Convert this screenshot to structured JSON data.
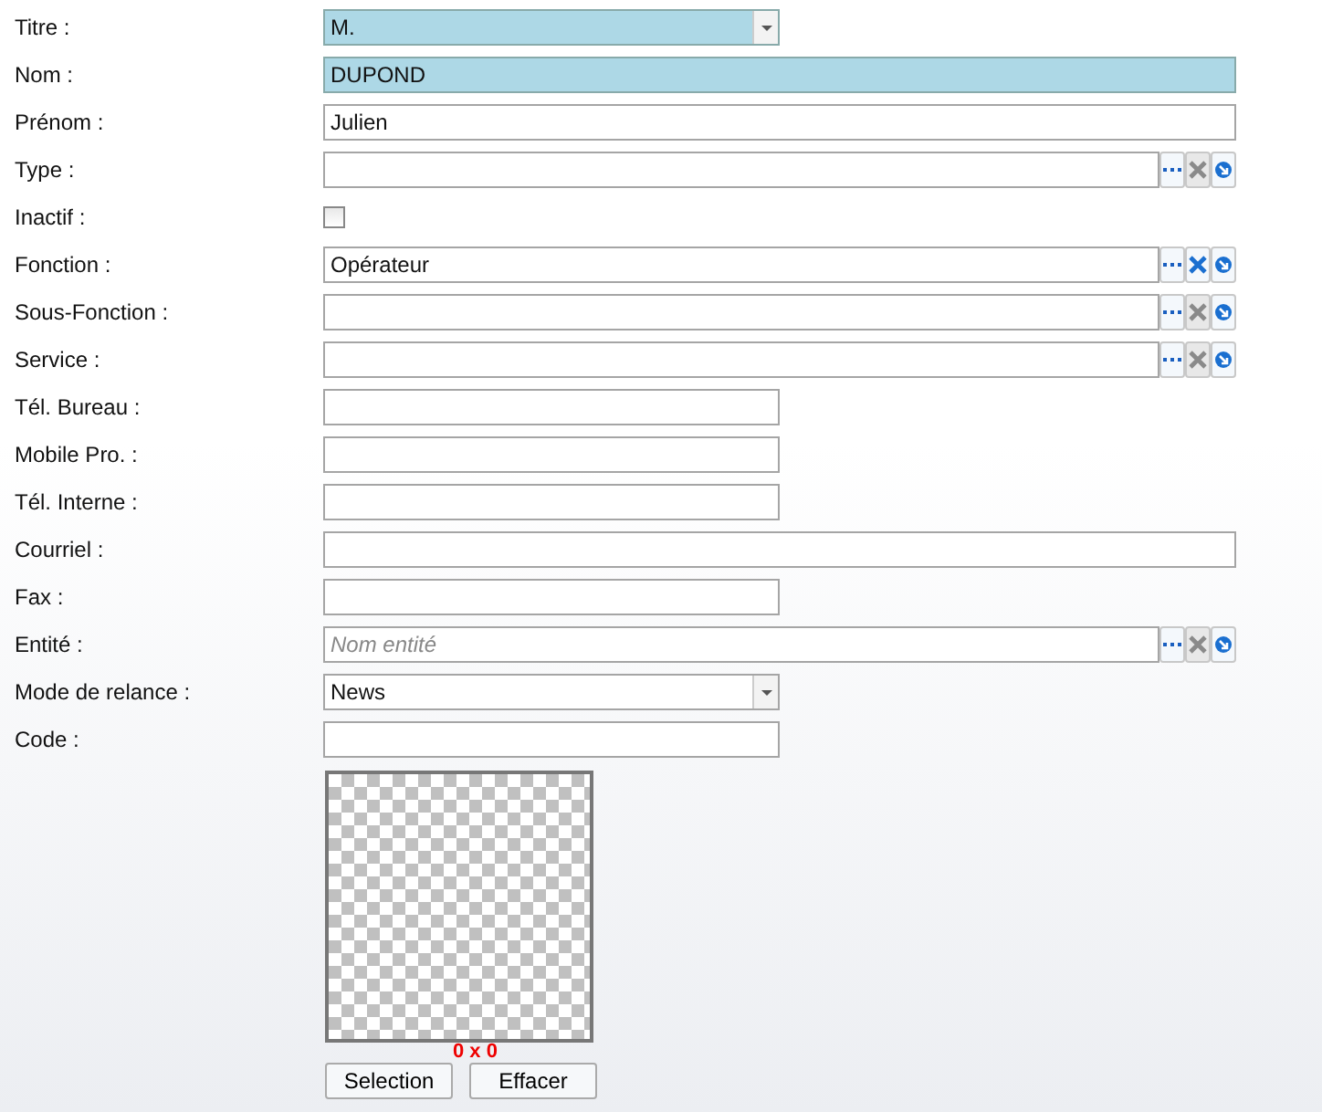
{
  "fields": [
    {
      "label": "Titre :",
      "kind": "select",
      "value": "M.",
      "required": true
    },
    {
      "label": "Nom :",
      "kind": "longtext",
      "value": "DUPOND",
      "required": true
    },
    {
      "label": "Prénom :",
      "kind": "longtext",
      "value": "Julien",
      "required": false
    },
    {
      "label": "Type :",
      "kind": "lookup",
      "clear_enabled": false
    },
    {
      "label": "Inactif :",
      "kind": "checkbox",
      "checked": false
    },
    {
      "label": "Fonction :",
      "kind": "lookup",
      "value": "Opérateur",
      "clear_enabled": true
    },
    {
      "label": "Sous-Fonction :",
      "kind": "lookup",
      "clear_enabled": false
    },
    {
      "label": "Service :",
      "kind": "lookup",
      "clear_enabled": false
    },
    {
      "label": "Tél. Bureau :",
      "kind": "shorttext",
      "required": false
    },
    {
      "label": "Mobile Pro. :",
      "kind": "shorttext",
      "required": false
    },
    {
      "label": "Tél. Interne :",
      "kind": "shorttext",
      "required": false
    },
    {
      "label": "Courriel :",
      "kind": "longtext",
      "required": false
    },
    {
      "label": "Fax :",
      "kind": "shorttext",
      "required": false
    },
    {
      "label": "Entité :",
      "kind": "lookup",
      "placeholder": "Nom entité",
      "clear_enabled": false
    },
    {
      "label": "Mode de relance :",
      "kind": "select",
      "value": "News",
      "required": false
    },
    {
      "label": "Code :",
      "kind": "shorttext",
      "required": false
    }
  ],
  "image": {
    "size_caption": "0 x 0",
    "buttons": [
      "Selection",
      "Effacer"
    ]
  }
}
